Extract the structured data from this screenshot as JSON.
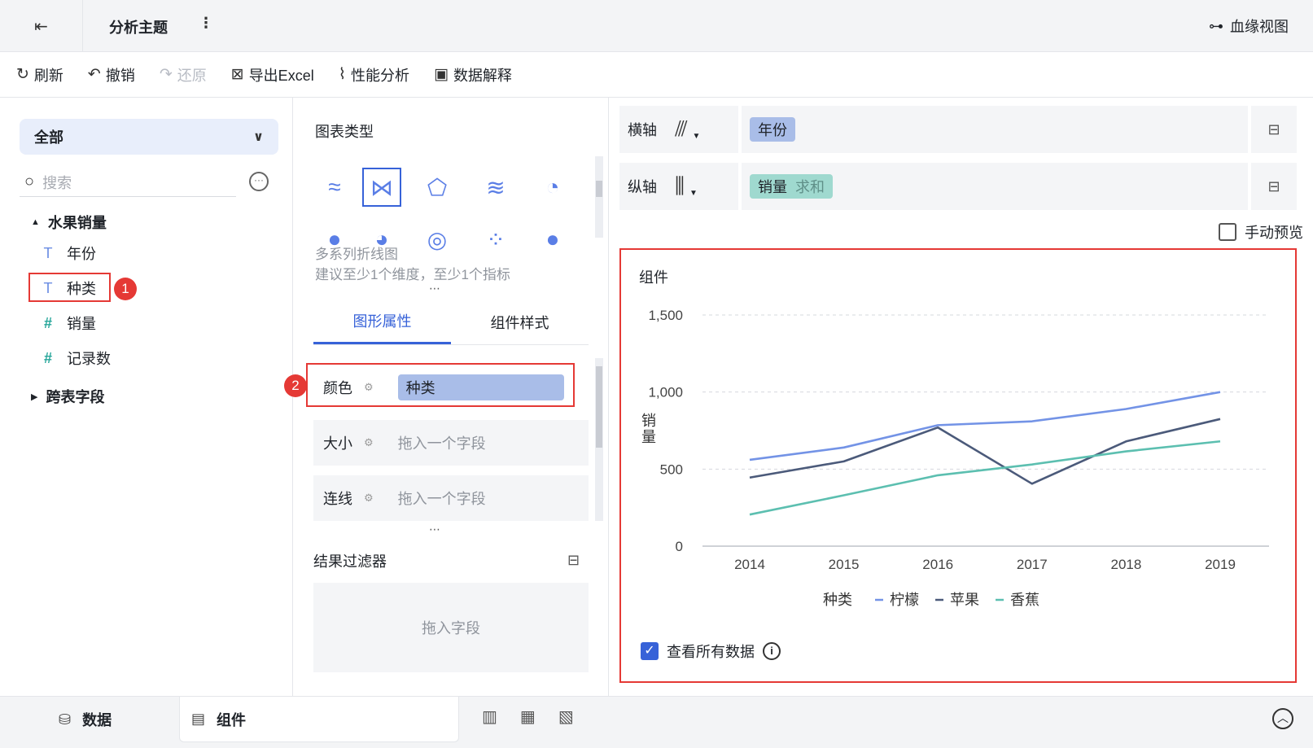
{
  "header": {
    "title": "分析主题",
    "lineage": "血缘视图"
  },
  "toolbar": {
    "refresh": "刷新",
    "undo": "撤销",
    "redo": "还原",
    "export": "导出Excel",
    "perf": "性能分析",
    "explain": "数据解释"
  },
  "left": {
    "scope": "全部",
    "search_placeholder": "搜索",
    "group": "水果销量",
    "fields": [
      "年份",
      "种类",
      "销量",
      "记录数"
    ],
    "cross": "跨表字段",
    "badge1": "1"
  },
  "mid": {
    "title": "图表类型",
    "hint_name": "多系列折线图",
    "hint_rule": "建议至少1个维度，至少1个指标",
    "tab_graphic": "图形属性",
    "tab_style": "组件样式",
    "props": {
      "color": "颜色",
      "color_field": "种类",
      "size": "大小",
      "line": "连线",
      "drop_placeholder": "拖入一个字段"
    },
    "badge2": "2",
    "filter_title": "结果过滤器",
    "filter_drop": "拖入字段"
  },
  "right": {
    "x_axis": "横轴",
    "x_field": "年份",
    "y_axis": "纵轴",
    "y_field": "销量",
    "y_agg": "求和",
    "manual_preview": "手动预览",
    "component_title": "组件",
    "view_all": "查看所有数据"
  },
  "chart_data": {
    "type": "line",
    "title": "组件",
    "xlabel": "",
    "ylabel": "销量",
    "categories": [
      "2014",
      "2015",
      "2016",
      "2017",
      "2018",
      "2019"
    ],
    "ylim": [
      0,
      1500
    ],
    "yticks": [
      "0",
      "500",
      "1,000",
      "1,500"
    ],
    "legend_title": "种类",
    "legend_position": "bottom",
    "grid": true,
    "series": [
      {
        "name": "柠檬",
        "color": "#7393e6",
        "values": [
          560,
          640,
          785,
          810,
          890,
          1000
        ]
      },
      {
        "name": "苹果",
        "color": "#4b5a7a",
        "values": [
          445,
          550,
          770,
          405,
          680,
          825
        ]
      },
      {
        "name": "香蕉",
        "color": "#5cbfb0",
        "values": [
          205,
          330,
          460,
          530,
          615,
          680
        ]
      }
    ]
  },
  "bottom": {
    "data_tab": "数据",
    "component_tab": "组件"
  }
}
